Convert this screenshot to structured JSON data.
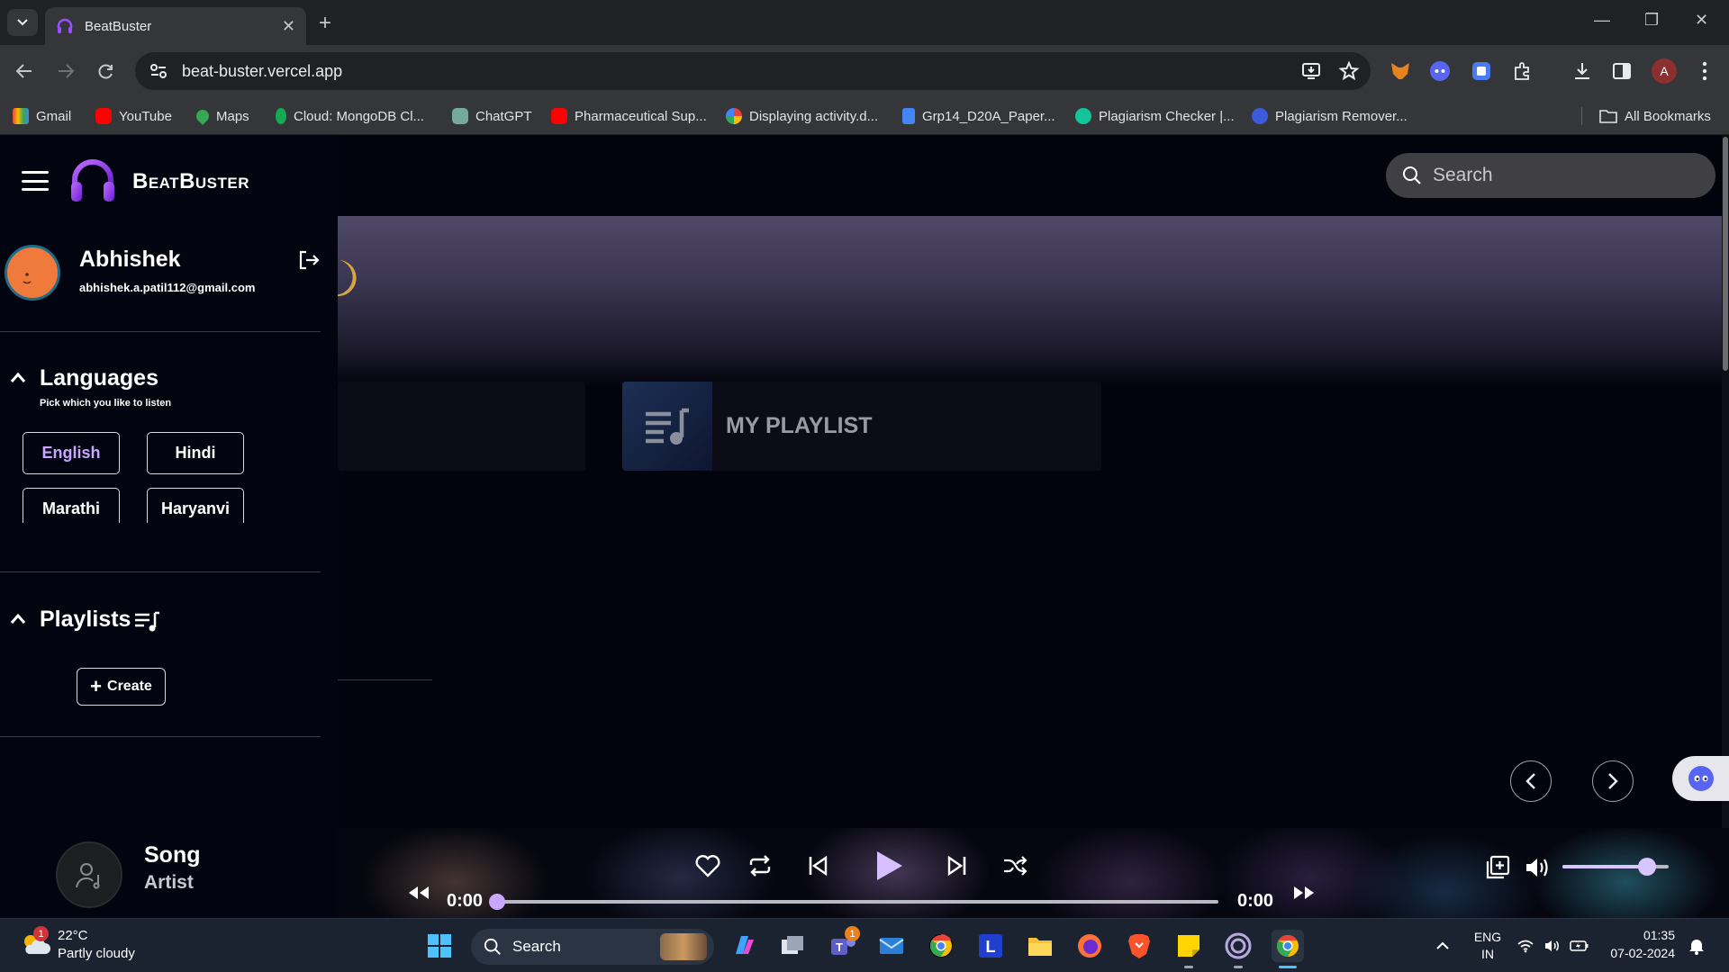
{
  "browser": {
    "tab_title": "BeatBuster",
    "url": "beat-buster.vercel.app",
    "bookmarks": [
      "Gmail",
      "YouTube",
      "Maps",
      "Cloud: MongoDB Cl...",
      "ChatGPT",
      "Pharmaceutical Sup...",
      "Displaying activity.d...",
      "Grp14_D20A_Paper...",
      "Plagiarism Checker |...",
      "Plagiarism Remover...",
      "All Bookmarks"
    ],
    "profile_initial": "A"
  },
  "app": {
    "brand": "BeatBuster",
    "user": {
      "name": "Abhishek",
      "email": "abhishek.a.patil112@gmail.com"
    },
    "languages": {
      "title": "Languages",
      "subtitle": "Pick which you like to listen",
      "options": [
        "English",
        "Hindi",
        "Marathi",
        "Haryanvi"
      ],
      "selected": "English"
    },
    "playlists": {
      "title": "Playlists",
      "create_label": "Create"
    },
    "search": {
      "placeholder": "Search"
    },
    "cards": {
      "playlist_label": "MY PLAYLIST"
    }
  },
  "player": {
    "song": "Song",
    "artist": "Artist",
    "current_time": "0:00",
    "total_time": "0:00",
    "progress": 0,
    "volume": 0.8
  },
  "taskbar": {
    "weather_temp": "22°C",
    "weather_cond": "Partly cloudy",
    "weather_badge": "1",
    "search_label": "Search",
    "teams_badge": "1",
    "lang_line1": "ENG",
    "lang_line2": "IN",
    "time": "01:35",
    "date": "07-02-2024"
  },
  "colors": {
    "accent": "#c8a8ff",
    "logo_purple": "#9b4dff",
    "background": "#02030c"
  }
}
